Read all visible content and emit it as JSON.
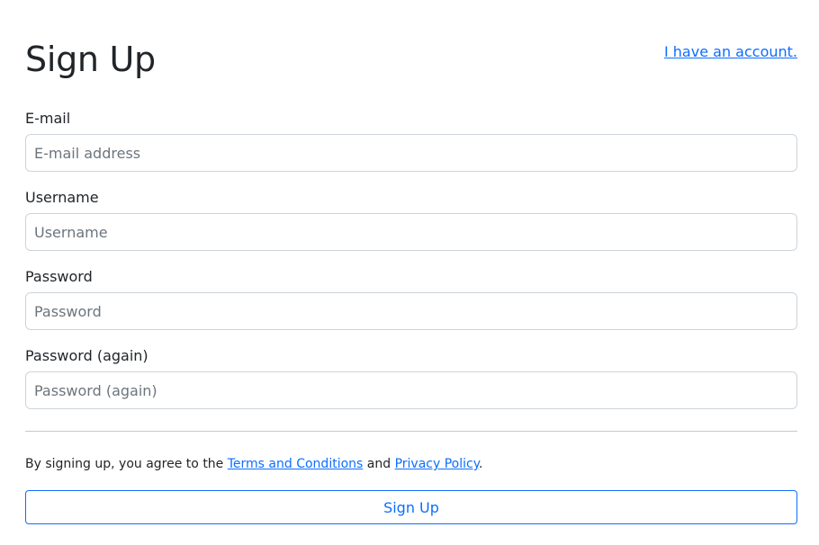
{
  "header": {
    "title": "Sign Up",
    "login_link": "I have an account."
  },
  "form": {
    "fields": [
      {
        "label": "E-mail",
        "placeholder": "E-mail address",
        "value": ""
      },
      {
        "label": "Username",
        "placeholder": "Username",
        "value": ""
      },
      {
        "label": "Password",
        "placeholder": "Password",
        "value": ""
      },
      {
        "label": "Password (again)",
        "placeholder": "Password (again)",
        "value": ""
      }
    ]
  },
  "terms": {
    "prefix": "By signing up, you agree to the ",
    "terms_link": "Terms and Conditions",
    "middle": " and ",
    "privacy_link": "Privacy Policy",
    "suffix": "."
  },
  "submit": {
    "label": "Sign Up"
  },
  "colors": {
    "accent": "#0d6efd",
    "text": "#212529",
    "placeholder": "#6c757d",
    "border": "#ced4da"
  }
}
